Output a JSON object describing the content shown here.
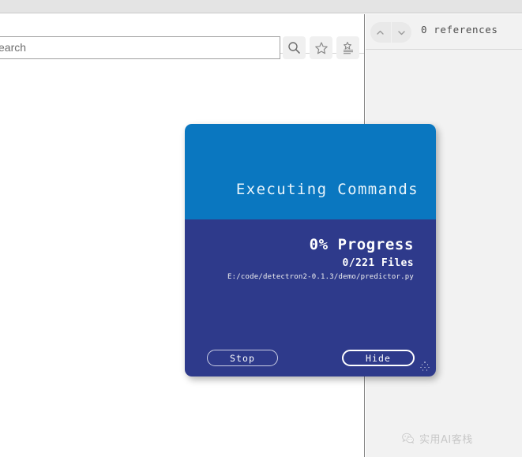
{
  "window": {
    "background_color": "#ffffff",
    "top_strip_color": "#e4e4e4"
  },
  "find_bar": {
    "search_input_value": "earch",
    "search_input_placeholder": "Search",
    "buttons": [
      {
        "name": "search-icon",
        "label": "Search"
      },
      {
        "name": "bookmark-star-icon",
        "label": "Bookmark"
      },
      {
        "name": "saved-searches-icon",
        "label": "Saved Searches"
      }
    ]
  },
  "references_bar": {
    "prev_label": "Previous",
    "next_label": "Next",
    "count_text": "0 references"
  },
  "dialog": {
    "title": "Executing Commands",
    "header_color": "#0a77c0",
    "body_color": "#2e3a8b",
    "progress_percent_text": "0% Progress",
    "files_text": "0/221 Files",
    "current_file_path": "E:/code/detectron2-0.1.3/demo/predictor.py",
    "stop_label": "Stop",
    "hide_label": "Hide",
    "resize_grip_name": "resize-grip"
  },
  "watermark": {
    "text": "实用AI客栈",
    "icon": "wechat-icon"
  }
}
